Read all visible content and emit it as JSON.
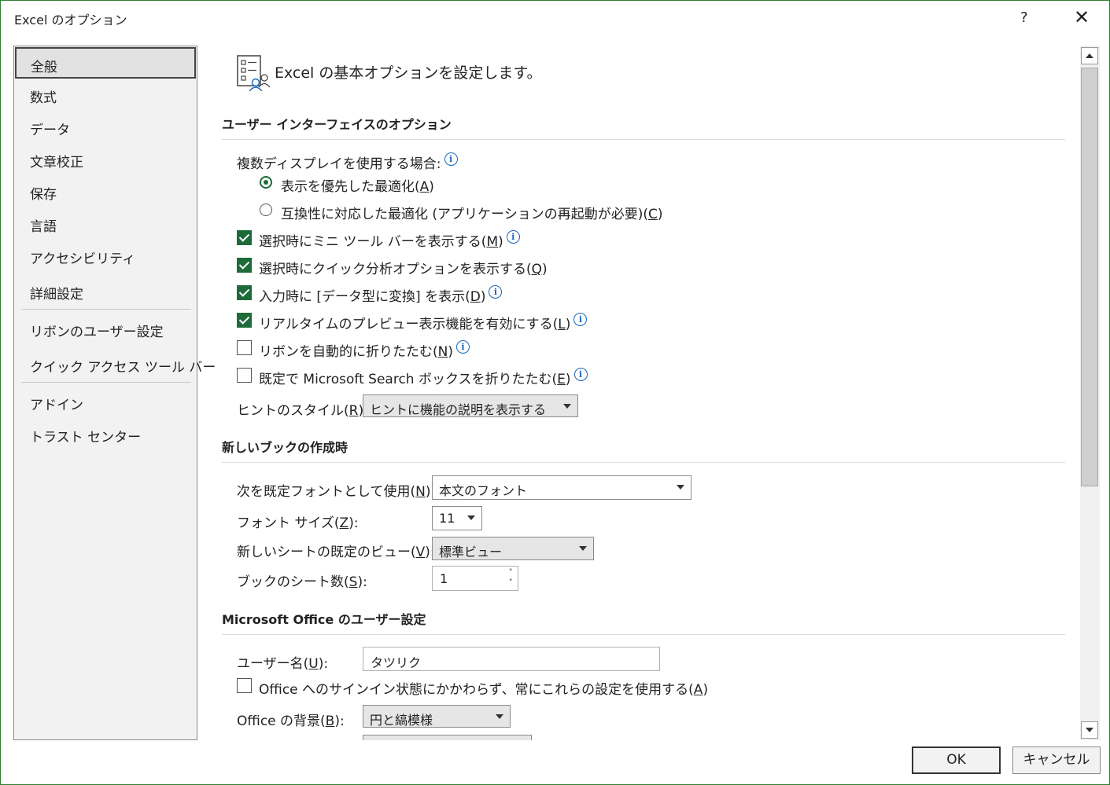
{
  "window": {
    "title": "Excel のオプション",
    "help_label": "?",
    "close_label": "✕"
  },
  "sidebar": {
    "items": [
      {
        "label": "全般",
        "selected": true
      },
      {
        "label": "数式"
      },
      {
        "label": "データ"
      },
      {
        "label": "文章校正"
      },
      {
        "label": "保存"
      },
      {
        "label": "言語"
      },
      {
        "label": "アクセシビリティ"
      },
      {
        "label": "詳細設定"
      },
      {
        "label": "リボンのユーザー設定"
      },
      {
        "label": "クイック アクセス ツール バー"
      },
      {
        "label": "アドイン"
      },
      {
        "label": "トラスト センター"
      }
    ]
  },
  "main": {
    "page_title": "Excel の基本オプションを設定します。",
    "ui_section": {
      "title": "ユーザー インターフェイスのオプション",
      "multi_display_label": "複数ディスプレイを使用する場合:",
      "radio_optimize_appearance": {
        "text": "表示を優先した最適化(",
        "key": "A",
        "end": ")",
        "checked": true
      },
      "radio_optimize_compat": {
        "text": "互換性に対応した最適化 (アプリケーションの再起動が必要)(",
        "key": "C",
        "end": ")",
        "checked": false
      },
      "cb_mini_toolbar": {
        "text": "選択時にミニ ツール バーを表示する(",
        "key": "M",
        "end": ")",
        "checked": true
      },
      "cb_quick_analysis": {
        "text": "選択時にクイック分析オプションを表示する(",
        "key": "Q",
        "end": ")",
        "checked": true
      },
      "cb_data_type": {
        "text": "入力時に [データ型に変換] を表示(",
        "key": "D",
        "end": ")",
        "checked": true
      },
      "cb_live_preview": {
        "text": "リアルタイムのプレビュー表示機能を有効にする(",
        "key": "L",
        "end": ")",
        "checked": true
      },
      "cb_collapse_ribbon": {
        "text": "リボンを自動的に折りたたむ(",
        "key": "N",
        "end": ")",
        "checked": false
      },
      "cb_collapse_search": {
        "text": "既定で Microsoft Search ボックスを折りたたむ(",
        "key": "E",
        "end": ")",
        "checked": false
      },
      "screentip_label": {
        "text": "ヒントのスタイル(",
        "key": "R",
        "end": "):"
      },
      "screentip_value": "ヒントに機能の説明を表示する"
    },
    "new_book_section": {
      "title": "新しいブックの作成時",
      "font_label": {
        "text": "次を既定フォントとして使用(",
        "key": "N",
        "end": "):"
      },
      "font_value": "本文のフォント",
      "size_label": {
        "text": "フォント サイズ(",
        "key": "Z",
        "end": "):"
      },
      "size_value": "11",
      "view_label": {
        "text": "新しいシートの既定のビュー(",
        "key": "V",
        "end": "):"
      },
      "view_value": "標準ビュー",
      "sheets_label": {
        "text": "ブックのシート数(",
        "key": "S",
        "end": "):"
      },
      "sheets_value": "1"
    },
    "office_section": {
      "title": "Microsoft Office のユーザー設定",
      "username_label": {
        "text": "ユーザー名(",
        "key": "U",
        "end": "):"
      },
      "username_value": "タツリク",
      "cb_always_use": {
        "text": "Office へのサインイン状態にかかわらず、常にこれらの設定を使用する(",
        "key": "A",
        "end": ")",
        "checked": false
      },
      "background_label": {
        "text": "Office の背景(",
        "key": "B",
        "end": "):"
      },
      "background_value": "円と縞模様"
    }
  },
  "footer": {
    "ok_label": "OK",
    "cancel_label": "キャンセル"
  },
  "colors": {
    "accent": "#1e6b3a",
    "info": "#1565c0"
  }
}
